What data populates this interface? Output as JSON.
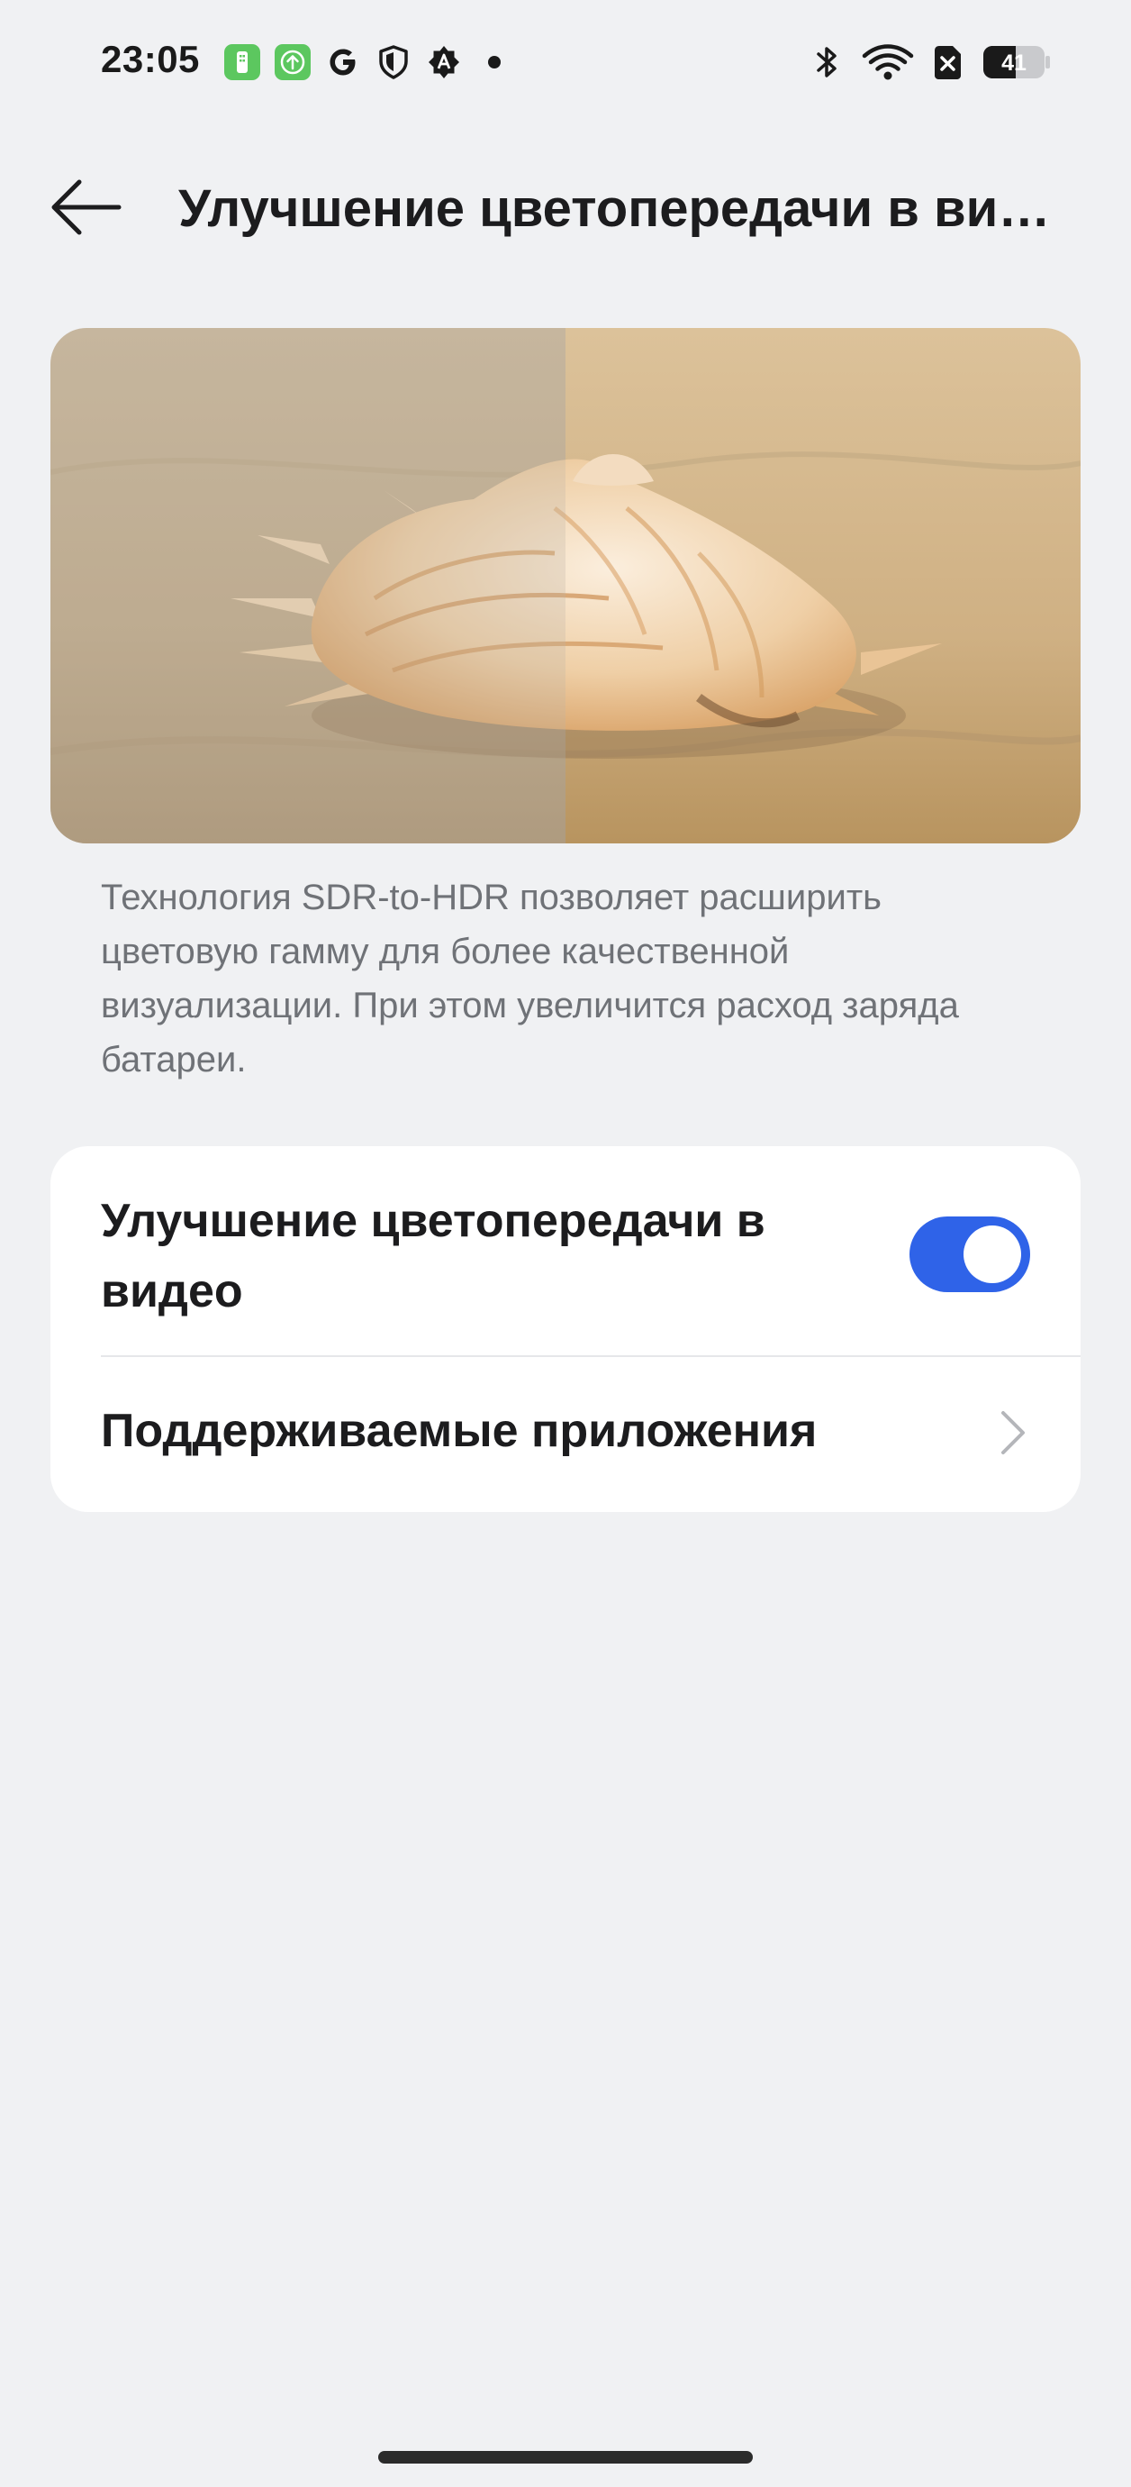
{
  "status_bar": {
    "time": "23:05",
    "battery_level": "41",
    "left_icons": [
      "cleaner-app-icon",
      "upload-app-icon",
      "google-icon",
      "shield-icon",
      "autofill-icon",
      "dot-icon"
    ],
    "right_icons": [
      "bluetooth-icon",
      "wifi-icon",
      "no-sim-icon",
      "battery-icon"
    ]
  },
  "header": {
    "title": "Улучшение цветопередачи в видео",
    "back_icon": "arrow-left-icon"
  },
  "hero": {
    "image": "seashell-on-sand-comparison"
  },
  "description": "Технология SDR-to-HDR позволяет расширить цветовую гамму для более качественной визуализации. При этом увеличится расход заряда батареи.",
  "settings": {
    "video_enhancement": {
      "label": "Улучшение цветопередачи в видео",
      "enabled": true
    },
    "supported_apps": {
      "label": "Поддерживаемые приложения",
      "icon": "chevron-right-icon"
    }
  },
  "colors": {
    "background": "#f0f1f3",
    "card": "#ffffff",
    "accent": "#2f63e8",
    "text_primary": "#1c1c1e",
    "text_secondary": "#6f7277"
  }
}
